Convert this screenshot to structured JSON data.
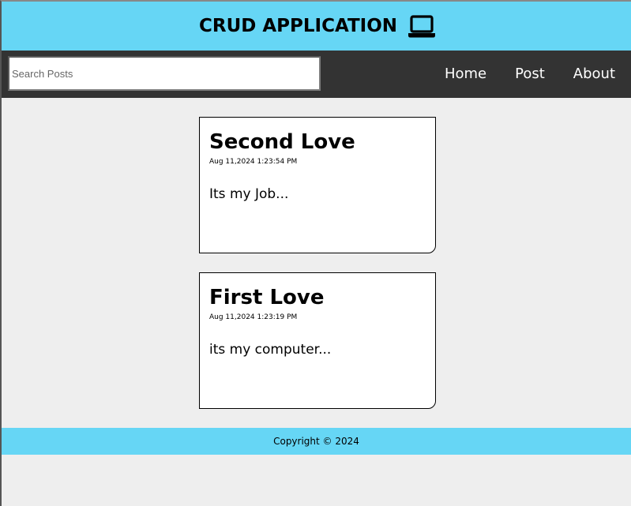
{
  "header": {
    "title": "CRUD APPLICATION",
    "icon": "laptop-icon",
    "background": "#66d6f5"
  },
  "navbar": {
    "background": "#333333",
    "search": {
      "value": "",
      "placeholder": "Search Posts"
    },
    "links": [
      {
        "label": "Home"
      },
      {
        "label": "Post"
      },
      {
        "label": "About"
      }
    ]
  },
  "posts": [
    {
      "title": "Second Love",
      "date": "Aug 11,2024 1:23:54 PM",
      "body": "Its my Job..."
    },
    {
      "title": "First Love",
      "date": "Aug 11,2024 1:23:19 PM",
      "body": "its my computer..."
    }
  ],
  "footer": {
    "text": "Copyright © 2024",
    "background": "#66d6f5"
  },
  "page": {
    "background": "#eeeeee"
  }
}
